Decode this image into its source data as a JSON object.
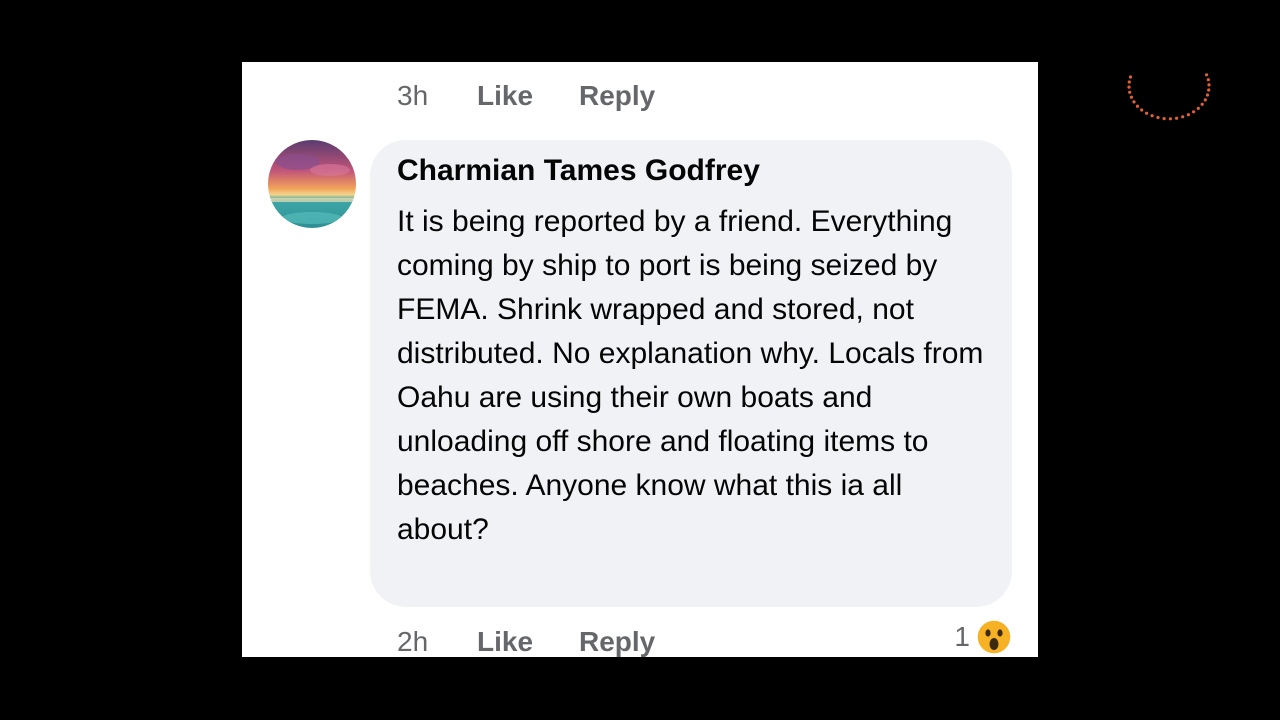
{
  "previous_comment": {
    "time": "3h",
    "like_label": "Like",
    "reply_label": "Reply"
  },
  "comment": {
    "author": "Charmian Tames Godfrey",
    "text": "It is being reported by a friend. Everything coming by ship to port is being seized by FEMA. Shrink wrapped and stored, not distributed. No explanation why. Locals from Oahu are using their own boats and unloading off shore and floating items to beaches. Anyone know what this ia all about?",
    "time": "2h",
    "like_label": "Like",
    "reply_label": "Reply",
    "reaction_count": "1",
    "reaction_icon": "wow-reaction-icon"
  },
  "colors": {
    "background": "#000000",
    "card": "#ffffff",
    "bubble": "#f0f2f5",
    "secondary_text": "#65676b",
    "primary_text": "#050505",
    "loader": "#e0603a"
  }
}
